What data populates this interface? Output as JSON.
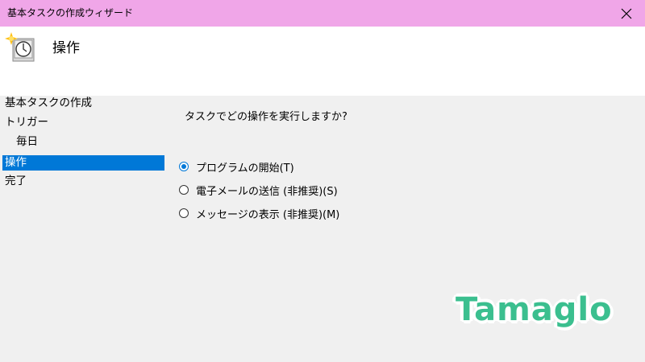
{
  "window": {
    "title": "基本タスクの作成ウィザード",
    "close_icon": "close-icon"
  },
  "header": {
    "icon": "task-scheduler-clock-icon",
    "heading": "操作"
  },
  "nav": {
    "items": [
      {
        "label": "基本タスクの作成",
        "active": false
      },
      {
        "label": "トリガー",
        "active": false
      },
      {
        "label": "毎日",
        "active": false,
        "sub": true
      },
      {
        "label": "操作",
        "active": true
      },
      {
        "label": "完了",
        "active": false
      }
    ]
  },
  "main": {
    "question": "タスクでどの操作を実行しますか?",
    "options": [
      {
        "label": "プログラムの開始(T)",
        "checked": true
      },
      {
        "label": "電子メールの送信 (非推奨)(S)",
        "checked": false
      },
      {
        "label": "メッセージの表示 (非推奨)(M)",
        "checked": false
      }
    ]
  },
  "watermark": {
    "text": "Tamaglo"
  },
  "colors": {
    "titlebar": "#f0a6e8",
    "selection": "#0078d7",
    "watermark": "#3bbf8f"
  }
}
